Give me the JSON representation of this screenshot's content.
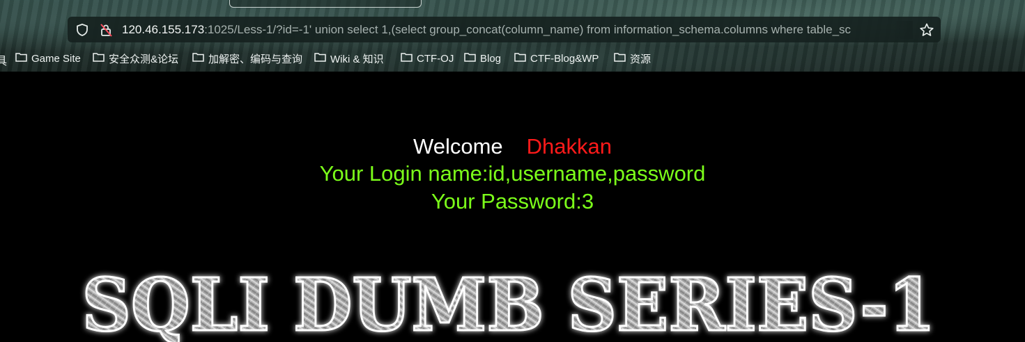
{
  "browser": {
    "url_host": "120.46.155.173",
    "url_rest": ":1025/Less-1/?id=-1' union select 1,(select group_concat(column_name) from information_schema.columns where table_sc",
    "bookmarks_lead": "具",
    "bookmarks": [
      {
        "label": "Game Site"
      },
      {
        "label": "安全众测&论坛"
      },
      {
        "label": "加解密、编码与查询"
      },
      {
        "label": "Wiki & 知识"
      },
      {
        "label": "CTF-OJ"
      },
      {
        "label": "Blog"
      },
      {
        "label": "CTF-Blog&WP"
      },
      {
        "label": "资源"
      }
    ]
  },
  "page": {
    "welcome": "Welcome",
    "user": "Dhakkan",
    "login_line": "Your Login name:id,username,password",
    "password_line": "Your Password:3",
    "banner_text": "SQLI DUMB SERIES-1"
  },
  "colors": {
    "welcome": "#ffffff",
    "user": "#ff1a1a",
    "result": "#7cff1a",
    "background": "#000000"
  }
}
